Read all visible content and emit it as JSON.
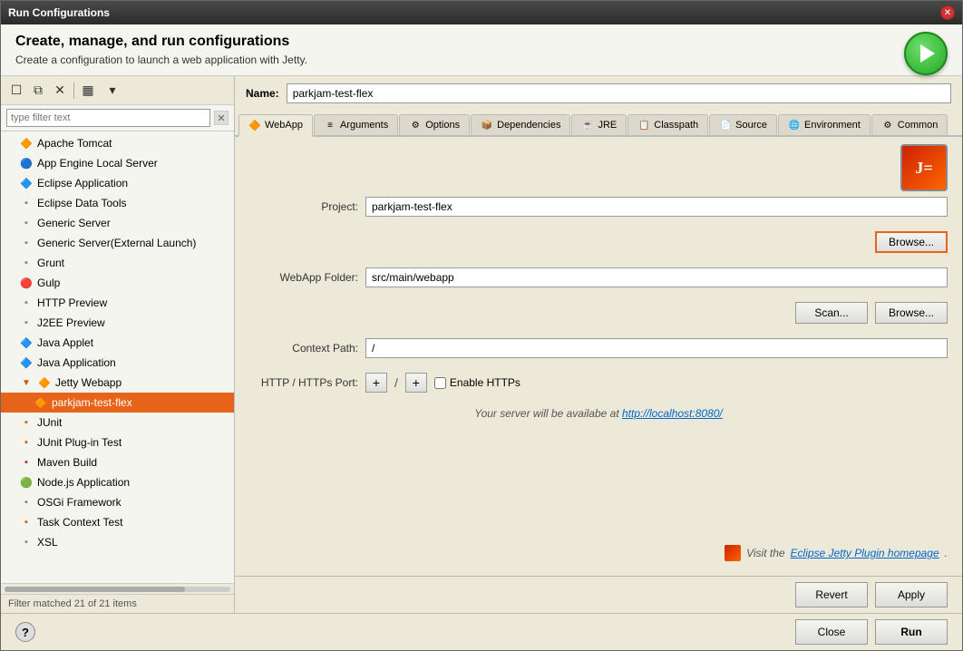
{
  "window": {
    "title": "Run Configurations"
  },
  "header": {
    "title": "Create, manage, and run configurations",
    "subtitle": "Create a configuration to launch a web application with Jetty."
  },
  "toolbar": {
    "new_btn": "☐",
    "copy_btn": "⧉",
    "delete_btn": "✕",
    "filter_btn": "▦",
    "config_btn": "▾"
  },
  "filter": {
    "placeholder": "type filter text"
  },
  "tree": {
    "items": [
      {
        "id": "apache-tomcat",
        "label": "Apache Tomcat",
        "icon": "🔶",
        "indent": 0
      },
      {
        "id": "app-engine",
        "label": "App Engine Local Server",
        "icon": "🔵",
        "indent": 0
      },
      {
        "id": "eclipse-app",
        "label": "Eclipse Application",
        "icon": "🔷",
        "indent": 0
      },
      {
        "id": "eclipse-data",
        "label": "Eclipse Data Tools",
        "icon": "▪",
        "indent": 0
      },
      {
        "id": "generic-server",
        "label": "Generic Server",
        "icon": "▪",
        "indent": 0
      },
      {
        "id": "generic-server-ext",
        "label": "Generic Server(External Launch)",
        "icon": "▪",
        "indent": 0
      },
      {
        "id": "grunt",
        "label": "Grunt",
        "icon": "▪",
        "indent": 0
      },
      {
        "id": "gulp",
        "label": "Gulp",
        "icon": "🔴",
        "indent": 0
      },
      {
        "id": "http-preview",
        "label": "HTTP Preview",
        "icon": "▪",
        "indent": 0
      },
      {
        "id": "j2ee-preview",
        "label": "J2EE Preview",
        "icon": "▪",
        "indent": 0
      },
      {
        "id": "java-applet",
        "label": "Java Applet",
        "icon": "🔷",
        "indent": 0
      },
      {
        "id": "java-application",
        "label": "Java Application",
        "icon": "🔷",
        "indent": 0
      },
      {
        "id": "jetty-webapp-group",
        "label": "Jetty Webapp",
        "icon": "▼",
        "indent": 0,
        "is_group": true
      },
      {
        "id": "parkjam-test-flex",
        "label": "parkjam-test-flex",
        "icon": "🔶",
        "indent": 1,
        "selected": true
      },
      {
        "id": "junit",
        "label": "JUnit",
        "icon": "▪",
        "indent": 0
      },
      {
        "id": "junit-plugin",
        "label": "JUnit Plug-in Test",
        "icon": "▪",
        "indent": 0
      },
      {
        "id": "maven-build",
        "label": "Maven Build",
        "icon": "▪",
        "indent": 0
      },
      {
        "id": "nodejs-app",
        "label": "Node.js Application",
        "icon": "🟢",
        "indent": 0
      },
      {
        "id": "osgi",
        "label": "OSGi Framework",
        "icon": "▪",
        "indent": 0
      },
      {
        "id": "task-context-test",
        "label": "Task Context Test",
        "icon": "▪",
        "indent": 0
      },
      {
        "id": "xsl",
        "label": "XSL",
        "icon": "▪",
        "indent": 0
      }
    ]
  },
  "filter_status": "Filter matched 21 of 21 items",
  "name_field": {
    "label": "Name:",
    "value": "parkjam-test-flex"
  },
  "tabs": [
    {
      "id": "webapp",
      "label": "WebApp",
      "icon": "🔶",
      "active": true
    },
    {
      "id": "arguments",
      "label": "Arguments",
      "icon": "≡"
    },
    {
      "id": "options",
      "label": "Options",
      "icon": "⚙"
    },
    {
      "id": "dependencies",
      "label": "Dependencies",
      "icon": "📦"
    },
    {
      "id": "jre",
      "label": "JRE",
      "icon": "☕"
    },
    {
      "id": "classpath",
      "label": "Classpath",
      "icon": "📋"
    },
    {
      "id": "source",
      "label": "Source",
      "icon": "📄"
    },
    {
      "id": "environment",
      "label": "Environment",
      "icon": "🌐"
    },
    {
      "id": "common",
      "label": "Common",
      "icon": "⚙"
    }
  ],
  "webapp": {
    "project_label": "Project:",
    "project_value": "parkjam-test-flex",
    "browse_label": "Browse...",
    "webapp_folder_label": "WebApp Folder:",
    "webapp_folder_value": "src/main/webapp",
    "scan_label": "Scan...",
    "browse2_label": "Browse...",
    "context_path_label": "Context Path:",
    "context_path_value": "/",
    "http_port_label": "HTTP / HTTPs Port:",
    "port_plus1": "+",
    "port_slash": "/",
    "port_plus2": "+",
    "enable_https_label": "Enable HTTPs",
    "server_message": "Your server will be availabe at",
    "server_link": "http://localhost:8080/",
    "jetty_link_prefix": "Visit the",
    "jetty_link": "Eclipse Jetty Plugin homepage",
    "jetty_link_suffix": "."
  },
  "buttons": {
    "revert": "Revert",
    "apply": "Apply",
    "close": "Close",
    "run": "Run"
  }
}
